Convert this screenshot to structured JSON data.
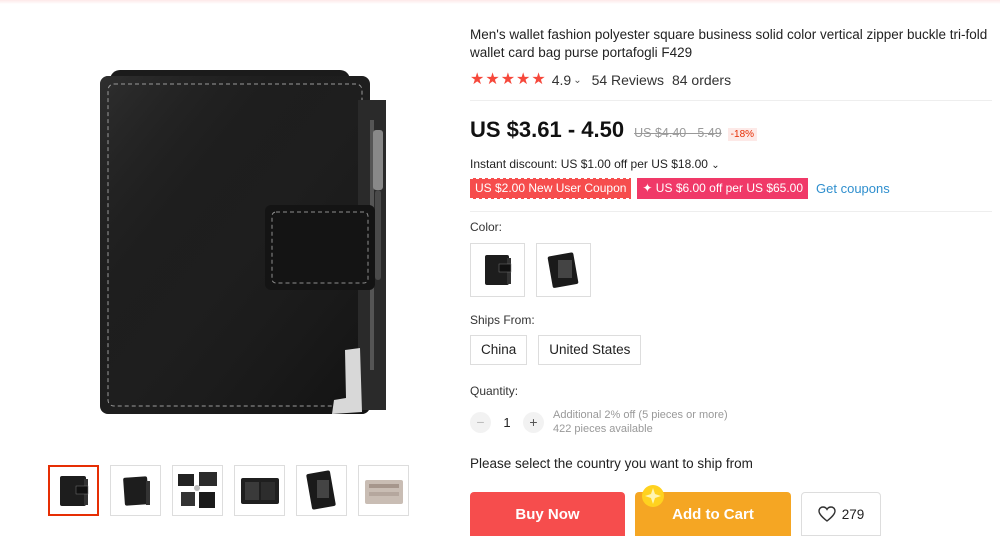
{
  "product": {
    "title": "Men's wallet fashion polyester square business solid color vertical zipper buckle tri-fold wallet card bag purse portafogli F429",
    "rating": "4.9",
    "reviews": "54 Reviews",
    "orders": "84 orders",
    "price": "US $3.61 - 4.50",
    "old_price": "US $4.40 - 5.49",
    "discount": "-18%",
    "instant_discount": "Instant discount: US $1.00 off per US $18.00",
    "coupons": [
      "US $2.00 New User Coupon",
      "✦ US $6.00 off per US $65.00"
    ],
    "get_coupons": "Get coupons"
  },
  "options": {
    "color_label": "Color:",
    "color_choices": [
      "black-wallet-front",
      "black-wallet-open"
    ],
    "ships_label": "Ships From:",
    "ships_from": [
      "China",
      "United States"
    ],
    "quantity_label": "Quantity:",
    "quantity": "1",
    "minus": "−",
    "plus": "+",
    "qty_note_line1": "Additional 2% off (5 pieces or more)",
    "qty_note_line2": "422 pieces available"
  },
  "ship_note": "Please select the country you want to ship from",
  "actions": {
    "buy_now": "Buy Now",
    "add_to_cart": "Add to Cart",
    "wishlist_count": "279"
  },
  "gallery": {
    "thumbnails": [
      "wallet-front",
      "wallet-angle",
      "wallet-contents",
      "wallet-open",
      "wallet-black-open",
      "wallet-brown"
    ],
    "active_thumbnail": 0
  },
  "colors": {
    "price_red": "#f64d4d",
    "cart_orange": "#f5a623",
    "star_red": "#f6483b",
    "link_blue": "#2f8fce"
  }
}
